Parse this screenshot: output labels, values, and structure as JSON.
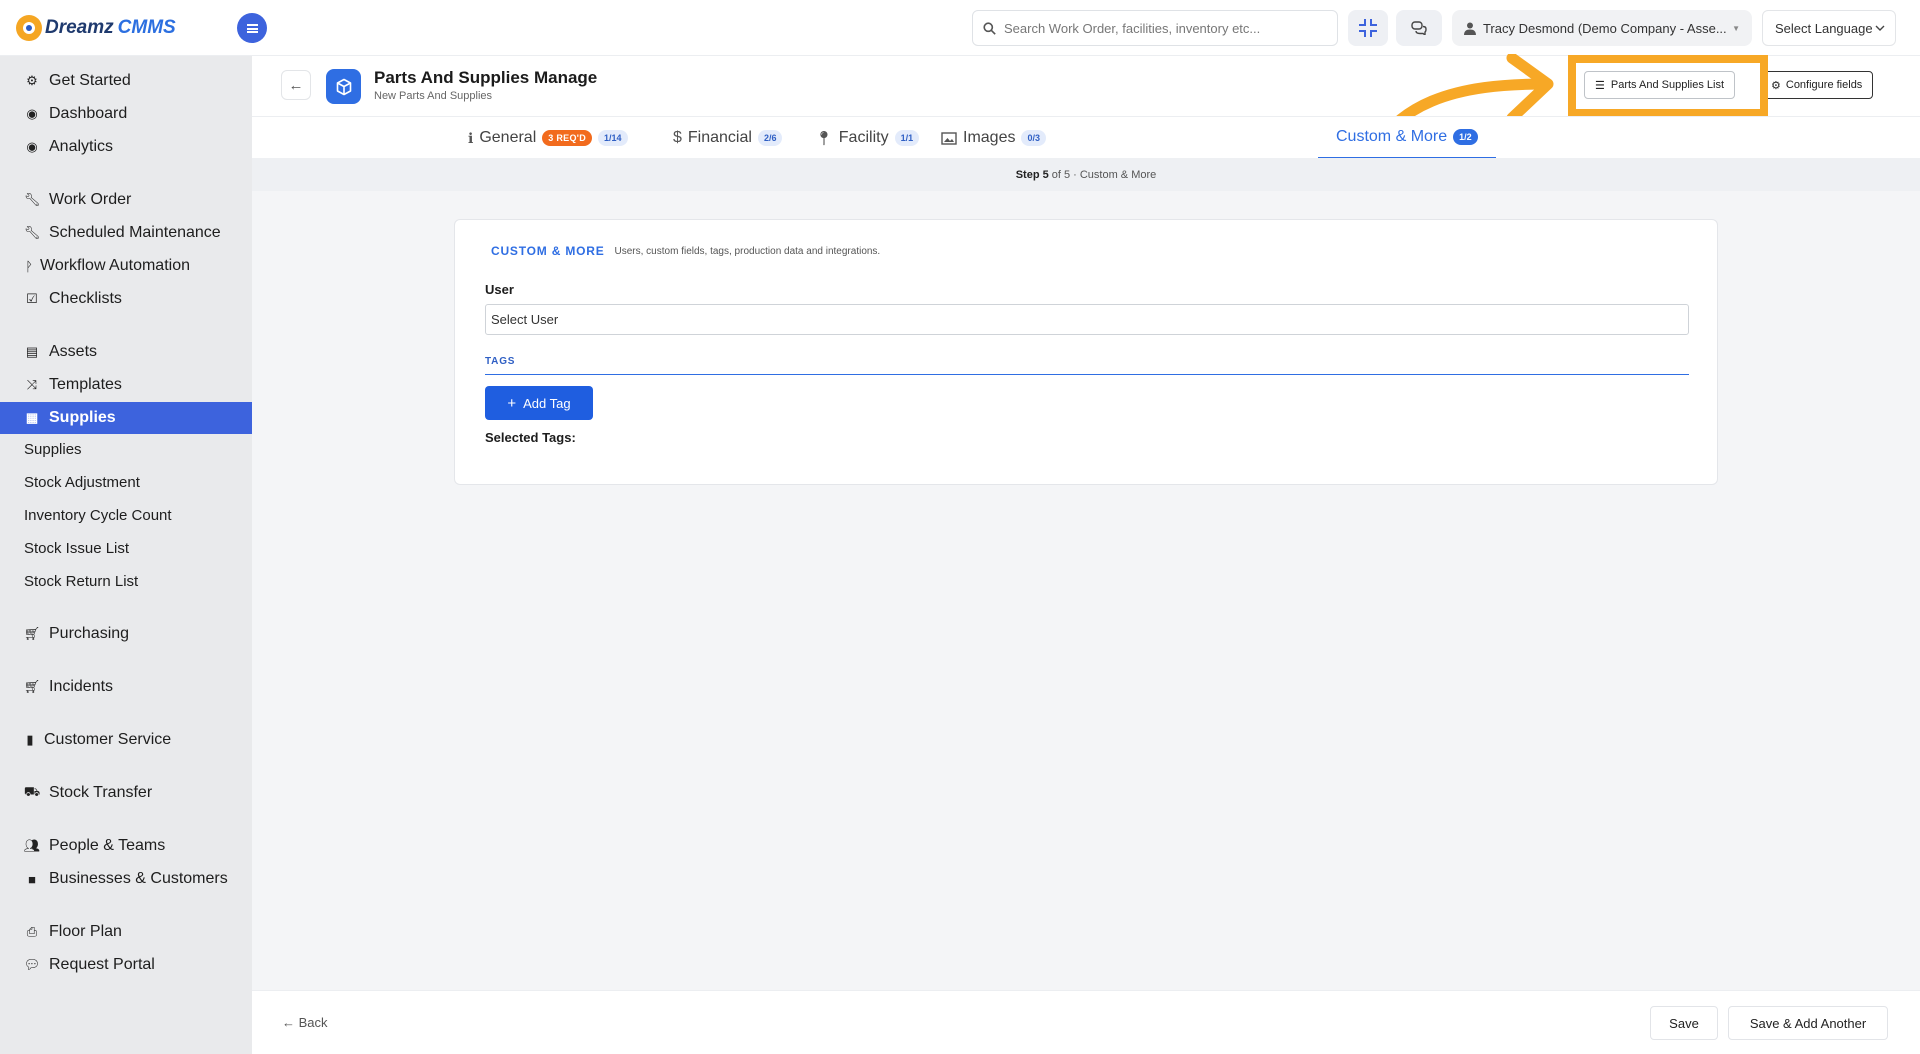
{
  "app": {
    "logo_word1": "Dreamz",
    "logo_word2": "CMMS"
  },
  "topbar": {
    "search_placeholder": "Search Work Order, facilities, inventory etc...",
    "user_label": "Tracy Desmond (Demo Company - Asse...",
    "language_label": "Select Language"
  },
  "sidebar": {
    "items": [
      {
        "label": "Get Started",
        "icon": "gears-icon"
      },
      {
        "label": "Dashboard",
        "icon": "gauge-icon"
      },
      {
        "label": "Analytics",
        "icon": "analytics-icon"
      },
      {
        "label": "Work Order",
        "icon": "wrench-icon"
      },
      {
        "label": "Scheduled Maintenance",
        "icon": "wrench-icon"
      },
      {
        "label": "Workflow Automation",
        "icon": "branch-icon"
      },
      {
        "label": "Checklists",
        "icon": "checkbox-icon"
      },
      {
        "label": "Assets",
        "icon": "archive-icon"
      },
      {
        "label": "Templates",
        "icon": "shuffle-icon"
      },
      {
        "label": "Supplies",
        "icon": "toolbox-icon"
      },
      {
        "label": "Purchasing",
        "icon": "cart-icon"
      },
      {
        "label": "Incidents",
        "icon": "cart-icon"
      },
      {
        "label": "Customer Service",
        "icon": "file-icon"
      },
      {
        "label": "Stock Transfer",
        "icon": "truck-icon"
      },
      {
        "label": "People & Teams",
        "icon": "users-icon"
      },
      {
        "label": "Businesses & Customers",
        "icon": "video-icon"
      },
      {
        "label": "Floor Plan",
        "icon": "printer-icon"
      },
      {
        "label": "Request Portal",
        "icon": "comment-icon"
      }
    ],
    "sub_items": [
      "Supplies",
      "Stock Adjustment",
      "Inventory Cycle Count",
      "Stock Issue List",
      "Stock Return List"
    ]
  },
  "page": {
    "title": "Parts And Supplies Manage",
    "subtitle": "New Parts And Supplies",
    "list_button": "Parts And Supplies List",
    "configure_button": "Configure fields"
  },
  "tabs": [
    {
      "label": "General",
      "req": "3 REQ'D",
      "count": "1/14"
    },
    {
      "label": "Financial",
      "count": "2/6"
    },
    {
      "label": "Facility",
      "count": "1/1"
    },
    {
      "label": "Images",
      "count": "0/3"
    },
    {
      "label": "Custom & More",
      "count": "1/2"
    }
  ],
  "step": {
    "prefix": "Step 5",
    "suffix": "of 5 · Custom & More"
  },
  "section": {
    "title": "CUSTOM & MORE",
    "description": "Users, custom fields, tags, production data and integrations.",
    "user_label": "User",
    "user_placeholder": "Select User",
    "tags_label": "TAGS",
    "add_tag": "Add Tag",
    "selected_tags": "Selected Tags:"
  },
  "footer": {
    "back": "Back",
    "save": "Save",
    "save_add": "Save & Add Another"
  },
  "colors": {
    "accent": "#3d63dd",
    "primary": "#2f6ee3",
    "highlight": "#f7a826",
    "required": "#f26b1d"
  }
}
